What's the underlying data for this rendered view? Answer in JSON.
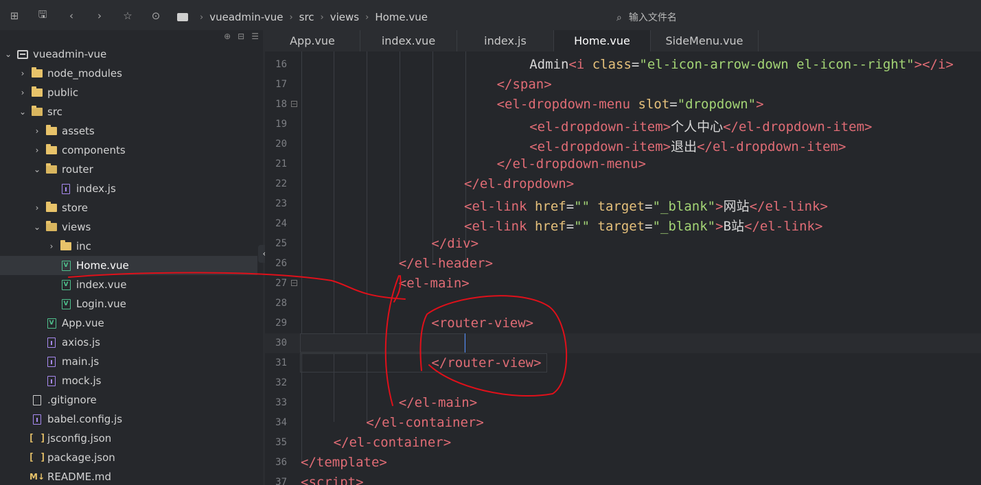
{
  "toolbar": {
    "buttons": [
      {
        "name": "new-file-icon",
        "glyph": "⊞"
      },
      {
        "name": "save-icon",
        "glyph": "🖫"
      },
      {
        "name": "back-icon",
        "glyph": "‹"
      },
      {
        "name": "forward-icon",
        "glyph": "›"
      },
      {
        "name": "star-icon",
        "glyph": "☆"
      },
      {
        "name": "run-icon",
        "glyph": "⊙"
      }
    ],
    "breadcrumb": [
      "vueadmin-vue",
      "src",
      "views",
      "Home.vue"
    ],
    "search_placeholder": "输入文件名"
  },
  "sidebar": {
    "tree": [
      {
        "label": "vueadmin-vue",
        "depth": 0,
        "chev": "⌄",
        "icon": "root"
      },
      {
        "label": "node_modules",
        "depth": 1,
        "chev": "›",
        "icon": "folder"
      },
      {
        "label": "public",
        "depth": 1,
        "chev": "›",
        "icon": "folder"
      },
      {
        "label": "src",
        "depth": 1,
        "chev": "⌄",
        "icon": "folder-open"
      },
      {
        "label": "assets",
        "depth": 2,
        "chev": "›",
        "icon": "folder"
      },
      {
        "label": "components",
        "depth": 2,
        "chev": "›",
        "icon": "folder"
      },
      {
        "label": "router",
        "depth": 2,
        "chev": "⌄",
        "icon": "folder-open"
      },
      {
        "label": "index.js",
        "depth": 3,
        "chev": "",
        "icon": "js"
      },
      {
        "label": "store",
        "depth": 2,
        "chev": "›",
        "icon": "folder"
      },
      {
        "label": "views",
        "depth": 2,
        "chev": "⌄",
        "icon": "folder-open"
      },
      {
        "label": "inc",
        "depth": 3,
        "chev": "›",
        "icon": "folder"
      },
      {
        "label": "Home.vue",
        "depth": 3,
        "chev": "",
        "icon": "vue",
        "selected": true
      },
      {
        "label": "index.vue",
        "depth": 3,
        "chev": "",
        "icon": "vue"
      },
      {
        "label": "Login.vue",
        "depth": 3,
        "chev": "",
        "icon": "vue"
      },
      {
        "label": "App.vue",
        "depth": 2,
        "chev": "",
        "icon": "vue"
      },
      {
        "label": "axios.js",
        "depth": 2,
        "chev": "",
        "icon": "js"
      },
      {
        "label": "main.js",
        "depth": 2,
        "chev": "",
        "icon": "js"
      },
      {
        "label": "mock.js",
        "depth": 2,
        "chev": "",
        "icon": "js"
      },
      {
        "label": ".gitignore",
        "depth": 1,
        "chev": "",
        "icon": "file"
      },
      {
        "label": "babel.config.js",
        "depth": 1,
        "chev": "",
        "icon": "js"
      },
      {
        "label": "jsconfig.json",
        "depth": 1,
        "chev": "",
        "icon": "json"
      },
      {
        "label": "package.json",
        "depth": 1,
        "chev": "",
        "icon": "json"
      },
      {
        "label": "README.md",
        "depth": 1,
        "chev": "",
        "icon": "md"
      }
    ]
  },
  "tabs": [
    {
      "label": "App.vue",
      "active": false
    },
    {
      "label": "index.vue",
      "active": false
    },
    {
      "label": "index.js",
      "active": false
    },
    {
      "label": "Home.vue",
      "active": true
    },
    {
      "label": "SideMenu.vue",
      "active": false
    }
  ],
  "editor": {
    "lines": [
      {
        "no": "16",
        "indent": 7,
        "fold": false,
        "tokens": [
          [
            "txt",
            "Admin"
          ],
          [
            "tag",
            "<i "
          ],
          [
            "attr",
            "class"
          ],
          [
            "txt",
            "="
          ],
          [
            "str",
            "\"el-icon-arrow-down el-icon--right\""
          ],
          [
            "tag",
            ">"
          ],
          [
            "tag",
            "</i>"
          ]
        ]
      },
      {
        "no": "17",
        "indent": 6,
        "fold": false,
        "tokens": [
          [
            "tag",
            "</span>"
          ]
        ]
      },
      {
        "no": "18",
        "indent": 6,
        "fold": true,
        "tokens": [
          [
            "tag",
            "<el-dropdown-menu "
          ],
          [
            "attr",
            "slot"
          ],
          [
            "txt",
            "="
          ],
          [
            "str",
            "\"dropdown\""
          ],
          [
            "tag",
            ">"
          ]
        ]
      },
      {
        "no": "19",
        "indent": 7,
        "fold": false,
        "tokens": [
          [
            "tag",
            "<el-dropdown-item>"
          ],
          [
            "txt",
            "个人中心"
          ],
          [
            "tag",
            "</el-dropdown-item>"
          ]
        ]
      },
      {
        "no": "20",
        "indent": 7,
        "fold": false,
        "tokens": [
          [
            "tag",
            "<el-dropdown-item>"
          ],
          [
            "txt",
            "退出"
          ],
          [
            "tag",
            "</el-dropdown-item>"
          ]
        ]
      },
      {
        "no": "21",
        "indent": 6,
        "fold": false,
        "tokens": [
          [
            "tag",
            "</el-dropdown-menu>"
          ]
        ]
      },
      {
        "no": "22",
        "indent": 5,
        "fold": false,
        "tokens": [
          [
            "tag",
            "</el-dropdown>"
          ]
        ]
      },
      {
        "no": "23",
        "indent": 5,
        "fold": false,
        "tokens": [
          [
            "tag",
            "<el-link "
          ],
          [
            "attr",
            "href"
          ],
          [
            "txt",
            "="
          ],
          [
            "str",
            "\"\" "
          ],
          [
            "attr",
            "target"
          ],
          [
            "txt",
            "="
          ],
          [
            "str",
            "\"_blank\""
          ],
          [
            "tag",
            ">"
          ],
          [
            "txt",
            "网站"
          ],
          [
            "tag",
            "</el-link>"
          ]
        ]
      },
      {
        "no": "24",
        "indent": 5,
        "fold": false,
        "tokens": [
          [
            "tag",
            "<el-link "
          ],
          [
            "attr",
            "href"
          ],
          [
            "txt",
            "="
          ],
          [
            "str",
            "\"\" "
          ],
          [
            "attr",
            "target"
          ],
          [
            "txt",
            "="
          ],
          [
            "str",
            "\"_blank\""
          ],
          [
            "tag",
            ">"
          ],
          [
            "txt",
            "B站"
          ],
          [
            "tag",
            "</el-link>"
          ]
        ]
      },
      {
        "no": "25",
        "indent": 4,
        "fold": false,
        "tokens": [
          [
            "tag",
            "</div>"
          ]
        ]
      },
      {
        "no": "26",
        "indent": 3,
        "fold": false,
        "tokens": [
          [
            "tag",
            "</el-header>"
          ]
        ]
      },
      {
        "no": "27",
        "indent": 3,
        "fold": true,
        "tokens": [
          [
            "tag",
            "<el-main>"
          ]
        ]
      },
      {
        "no": "28",
        "indent": 0,
        "fold": false,
        "tokens": []
      },
      {
        "no": "29",
        "indent": 4,
        "fold": false,
        "tokens": [
          [
            "tag",
            "<router-view>"
          ]
        ]
      },
      {
        "no": "30",
        "indent": 0,
        "fold": false,
        "tokens": [],
        "current": true
      },
      {
        "no": "31",
        "indent": 4,
        "fold": false,
        "tokens": [
          [
            "tag",
            "</router-view>"
          ]
        ]
      },
      {
        "no": "32",
        "indent": 0,
        "fold": false,
        "tokens": []
      },
      {
        "no": "33",
        "indent": 3,
        "fold": false,
        "tokens": [
          [
            "tag",
            "</el-main>"
          ]
        ]
      },
      {
        "no": "34",
        "indent": 2,
        "fold": false,
        "tokens": [
          [
            "tag",
            "</el-container>"
          ]
        ]
      },
      {
        "no": "35",
        "indent": 1,
        "fold": false,
        "tokens": [
          [
            "tag",
            "</el-container>"
          ]
        ]
      },
      {
        "no": "36",
        "indent": 0,
        "fold": false,
        "tokens": [
          [
            "tag",
            "</template>"
          ]
        ]
      },
      {
        "no": "37",
        "indent": 0,
        "fold": false,
        "tokens": [
          [
            "tag",
            "<script>"
          ]
        ]
      }
    ]
  },
  "colors": {
    "tag": "#e06c75",
    "attr": "#e5c07b",
    "string": "#a3d475",
    "annotation": "#e0101a"
  }
}
